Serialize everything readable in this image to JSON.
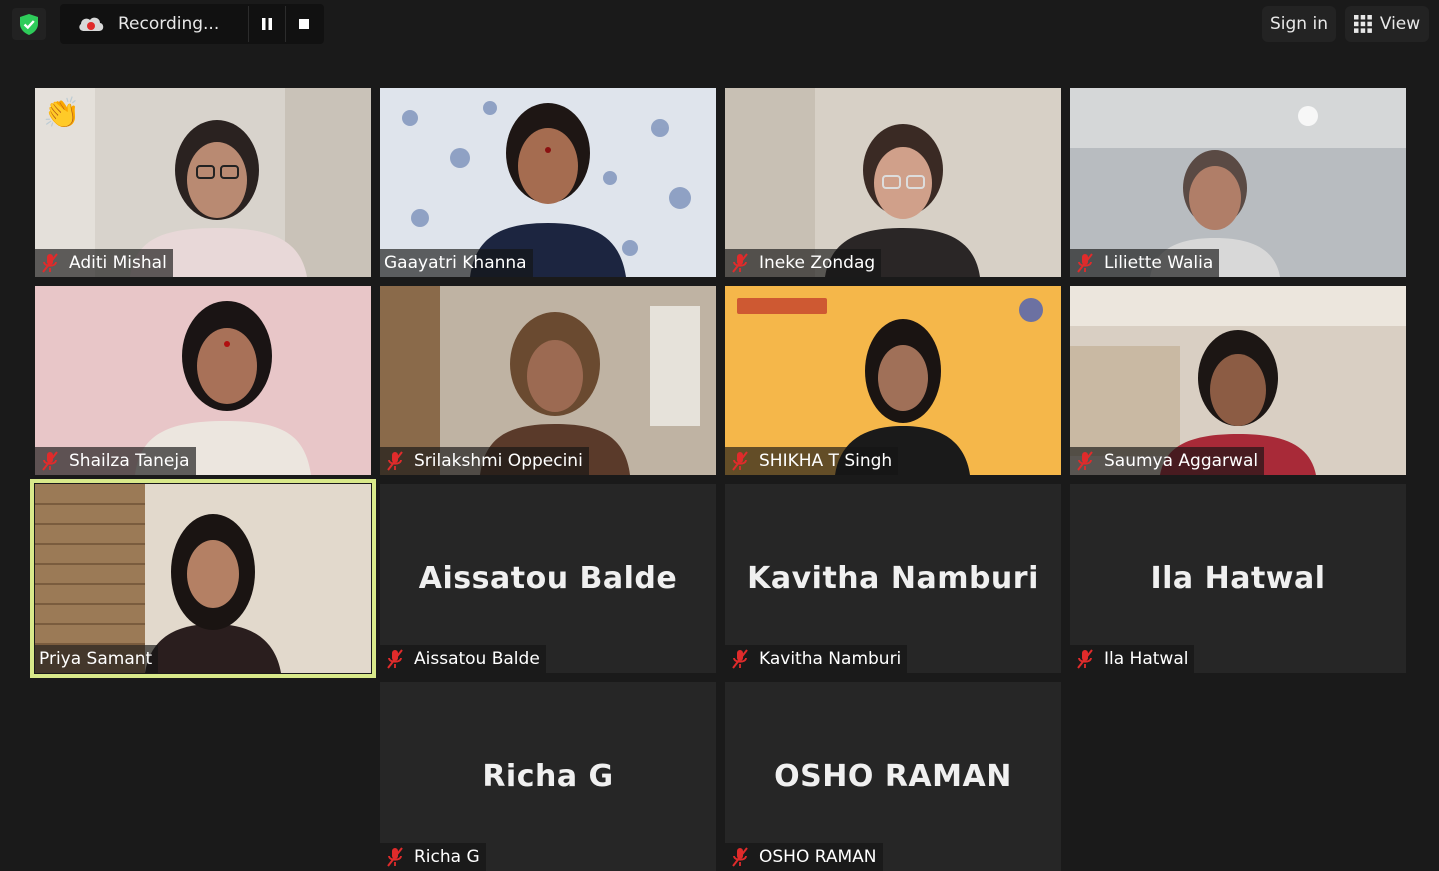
{
  "toolbar": {
    "recording_label": "Recording...",
    "signin_label": "Sign in",
    "view_label": "View",
    "icons": [
      "shield-check-icon",
      "cloud-record-icon",
      "pause-icon",
      "stop-icon",
      "grid-icon"
    ]
  },
  "colors": {
    "background": "#1a1a1a",
    "active_speaker_border": "#d9e98a",
    "mute_red": "#e02b2b",
    "shield_green": "#2ecc5a"
  },
  "participants": [
    {
      "name": "Aditi Mishal",
      "muted": true,
      "video": true,
      "reaction": "👏"
    },
    {
      "name": "Gaayatri Khanna",
      "muted": false,
      "video": true
    },
    {
      "name": "Ineke Zondag",
      "muted": true,
      "video": true
    },
    {
      "name": "Liliette Walia",
      "muted": true,
      "video": true
    },
    {
      "name": "Shailza Taneja",
      "muted": true,
      "video": true
    },
    {
      "name": "Srilakshmi Oppecini",
      "muted": true,
      "video": true
    },
    {
      "name": "SHIKHA T Singh",
      "muted": true,
      "video": true
    },
    {
      "name": "Saumya Aggarwal",
      "muted": true,
      "video": true
    },
    {
      "name": "Priya Samant",
      "muted": false,
      "video": true,
      "active_speaker": true
    },
    {
      "name": "Aissatou Balde",
      "muted": true,
      "video": false
    },
    {
      "name": "Kavitha Namburi",
      "muted": true,
      "video": false
    },
    {
      "name": "Ila Hatwal",
      "muted": true,
      "video": false
    },
    {
      "name": "Richa G",
      "muted": true,
      "video": false
    },
    {
      "name": "OSHO RAMAN",
      "muted": true,
      "video": false
    }
  ]
}
